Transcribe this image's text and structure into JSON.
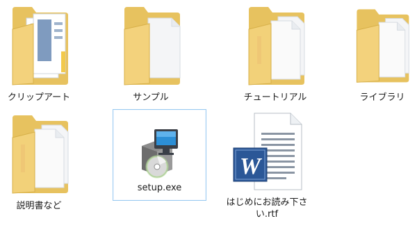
{
  "items": [
    {
      "label": "クリップアート",
      "type": "folder",
      "icon": "folder-icon"
    },
    {
      "label": "サンプル",
      "type": "folder",
      "icon": "folder-icon"
    },
    {
      "label": "チュートリアル",
      "type": "folder",
      "icon": "folder-icon"
    },
    {
      "label": "ライブラリ",
      "type": "folder",
      "icon": "folder-icon"
    },
    {
      "label": "説明書など",
      "type": "folder",
      "icon": "folder-icon"
    },
    {
      "label": "setup.exe",
      "type": "executable",
      "icon": "installer-icon",
      "selected": true
    },
    {
      "label": "はじめにお読み下さい.rtf",
      "type": "document",
      "icon": "word-document-icon"
    }
  ],
  "colors": {
    "folder_front": "#f5d98a",
    "folder_back": "#e7c25f",
    "selection_border": "#99c9f0",
    "word_blue": "#2b5797"
  }
}
